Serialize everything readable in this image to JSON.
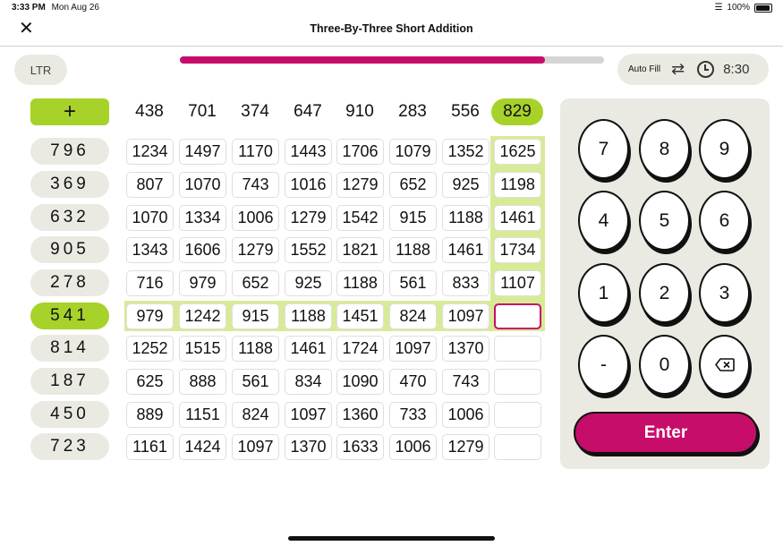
{
  "status_bar": {
    "time": "3:33 PM",
    "date": "Mon Aug 26",
    "battery": "100%"
  },
  "header": {
    "title": "Three-By-Three Short Addition",
    "close_icon": "close-icon"
  },
  "toolbar": {
    "direction_label": "LTR",
    "auto_fill_label": "Auto Fill",
    "timer": "8:30",
    "progress": 0.86
  },
  "grid": {
    "operator": "+",
    "columns": [
      "438",
      "701",
      "374",
      "647",
      "910",
      "283",
      "556",
      "829"
    ],
    "rows": [
      {
        "label": "796",
        "cells": [
          "1234",
          "1497",
          "1170",
          "1443",
          "1706",
          "1079",
          "1352",
          "1625"
        ]
      },
      {
        "label": "369",
        "cells": [
          "807",
          "1070",
          "743",
          "1016",
          "1279",
          "652",
          "925",
          "1198"
        ]
      },
      {
        "label": "632",
        "cells": [
          "1070",
          "1334",
          "1006",
          "1279",
          "1542",
          "915",
          "1188",
          "1461"
        ]
      },
      {
        "label": "905",
        "cells": [
          "1343",
          "1606",
          "1279",
          "1552",
          "1821",
          "1188",
          "1461",
          "1734"
        ]
      },
      {
        "label": "278",
        "cells": [
          "716",
          "979",
          "652",
          "925",
          "1188",
          "561",
          "833",
          "1107"
        ]
      },
      {
        "label": "541",
        "cells": [
          "979",
          "1242",
          "915",
          "1188",
          "1451",
          "824",
          "1097",
          ""
        ]
      },
      {
        "label": "814",
        "cells": [
          "1252",
          "1515",
          "1188",
          "1461",
          "1724",
          "1097",
          "1370",
          ""
        ]
      },
      {
        "label": "187",
        "cells": [
          "625",
          "888",
          "561",
          "834",
          "1090",
          "470",
          "743",
          ""
        ]
      },
      {
        "label": "450",
        "cells": [
          "889",
          "1151",
          "824",
          "1097",
          "1360",
          "733",
          "1006",
          ""
        ]
      },
      {
        "label": "723",
        "cells": [
          "1161",
          "1424",
          "1097",
          "1370",
          "1633",
          "1006",
          "1279",
          ""
        ]
      }
    ],
    "active_row": 5,
    "active_col": 7
  },
  "keypad": {
    "keys": [
      "7",
      "8",
      "9",
      "4",
      "5",
      "6",
      "1",
      "2",
      "3",
      "-",
      "0",
      "backspace"
    ],
    "enter_label": "Enter"
  },
  "colors": {
    "accent_green": "#a7d22a",
    "highlight_green": "#d7eb97",
    "brand_magenta": "#c70d6a",
    "panel_bg": "#eaeae3"
  }
}
